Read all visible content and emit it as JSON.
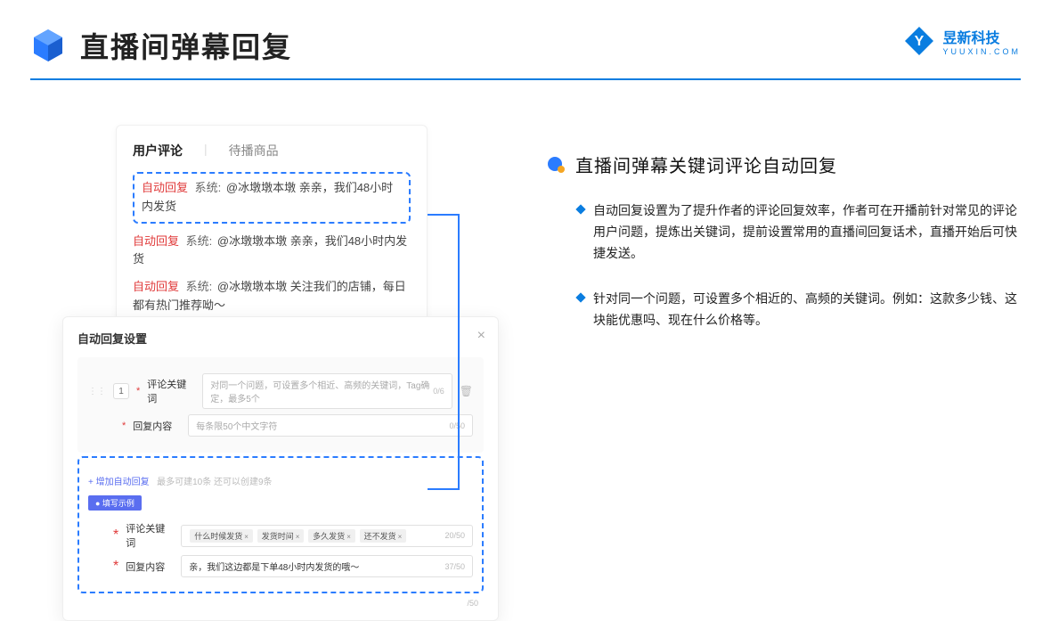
{
  "header": {
    "title": "直播间弹幕回复",
    "brand_name": "昱新科技",
    "brand_url": "YUUXIN.COM"
  },
  "comments_panel": {
    "tab_active": "用户评论",
    "tab_other": "待播商品",
    "rows": [
      {
        "auto": "自动回复",
        "sys": "系统:",
        "text": "@冰墩墩本墩 亲亲，我们48小时内发货"
      },
      {
        "auto": "自动回复",
        "sys": "系统:",
        "text": "@冰墩墩本墩 亲亲，我们48小时内发货"
      },
      {
        "auto": "自动回复",
        "sys": "系统:",
        "text": "@冰墩墩本墩 关注我们的店铺，每日都有热门推荐呦～"
      }
    ]
  },
  "modal": {
    "title": "自动回复设置",
    "index": "1",
    "kw_label": "评论关键词",
    "kw_placeholder": "对同一个问题，可设置多个相近、高频的关键词，Tag确定，最多5个",
    "kw_count": "0/6",
    "content_label": "回复内容",
    "content_placeholder": "每条限50个中文字符",
    "content_count": "0/50",
    "add_text": "+ 增加自动回复",
    "add_hint": "最多可建10条 还可以创建9条",
    "example_badge": "● 填写示例",
    "ex_kw_label": "评论关键词",
    "ex_tags": [
      "什么时候发货",
      "发货时间",
      "多久发货",
      "还不发货"
    ],
    "ex_kw_count": "20/50",
    "ex_content_label": "回复内容",
    "ex_content_value": "亲，我们这边都是下单48小时内发货的哦～",
    "ex_content_count": "37/50",
    "side_count": "/50"
  },
  "right": {
    "section_title": "直播间弹幕关键词评论自动回复",
    "bullets": [
      "自动回复设置为了提升作者的评论回复效率，作者可在开播前针对常见的评论用户问题，提炼出关键词，提前设置常用的直播间回复话术，直播开始后可快捷发送。",
      "针对同一个问题，可设置多个相近的、高频的关键词。例如：这款多少钱、这块能优惠吗、现在什么价格等。"
    ]
  }
}
